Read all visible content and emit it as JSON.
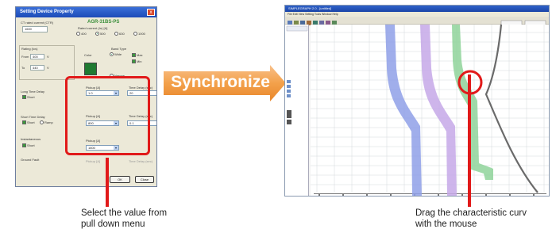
{
  "dialog": {
    "title": "Setting Device Property",
    "close_glyph": "x",
    "heading": "AGR-31BS-PS",
    "ct_rated_label": "CT rated current (CTR)",
    "ct_rated_value": "1600",
    "rated_current_label": "Rated current (In) [A]",
    "rated_options": [
      "400",
      "500",
      "630",
      "1000"
    ],
    "rating_label": "Rating (Ics)",
    "color_label": "Color",
    "band_type_label": "Band Type",
    "from_label": "From",
    "from_value": "400",
    "from_unit": "V",
    "to_label": "To",
    "to_value": "440",
    "to_unit": "V",
    "band_options": [
      "Wide",
      "Max",
      "Min",
      "Narrow"
    ],
    "long_time_label": "Long Time Delay",
    "short_label": "Short",
    "short_time_label": "Short Time Delay",
    "ramp_label": "Ramp",
    "instantaneous_label": "Instantaneous",
    "ground_fault_label": "Ground Fault",
    "pickup_label": "Pickup [A]",
    "time_delay_label": "Time Delay (sec)",
    "ltd_pickup": "1.0",
    "ltd_delay": "20",
    "std_pickup": "800",
    "std_delay": "0.1",
    "inst_pickup": "1600",
    "ok_label": "OK",
    "close_label": "Close"
  },
  "arrow_label": "Synchronize",
  "app": {
    "title": "SIMPLEGRAPH 2.0 - [untitled]",
    "menu": "File  Edit  View  Setting  Tools  Window  Help"
  },
  "captions": {
    "left_line1": "Select the value from",
    "left_line2": "pull down menu",
    "right_line1": "Drag the characteristic curv",
    "right_line2": "with the mouse"
  },
  "colors": {
    "accent_red": "#e11a1a",
    "arrow_orange": "#f3a14b",
    "curve_blue": "#8fa0e8",
    "curve_purple": "#c6a8e8",
    "curve_green": "#8fd49a",
    "curve_gray": "#6a6a6a"
  }
}
